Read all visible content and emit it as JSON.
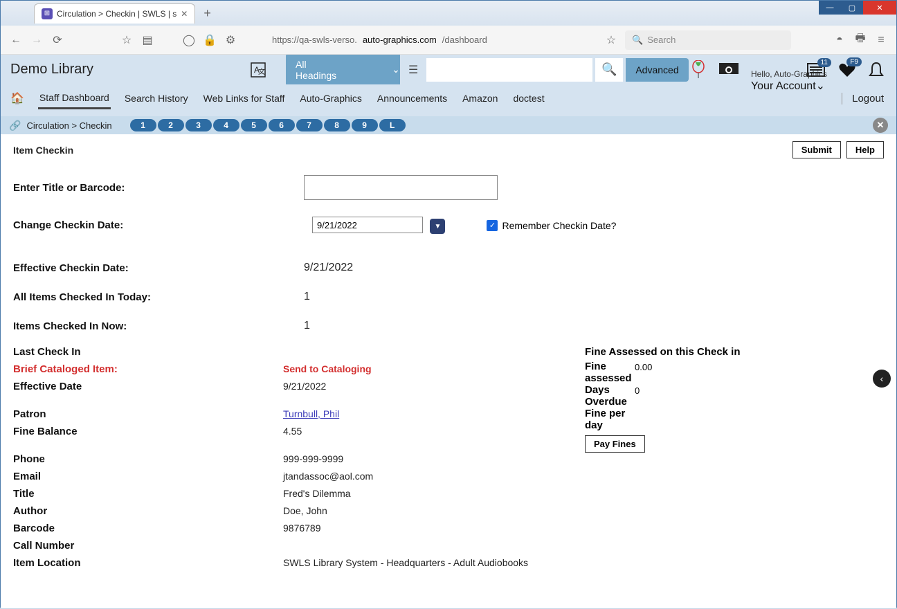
{
  "tab": {
    "title": "Circulation > Checkin | SWLS | s"
  },
  "url": {
    "prefix": "https://qa-swls-verso.",
    "domain": "auto-graphics.com",
    "path": "/dashboard"
  },
  "browser_search_placeholder": "Search",
  "header": {
    "library_name": "Demo Library",
    "heading_dropdown": "All Headings",
    "advanced": "Advanced",
    "badge_list": "11",
    "badge_heart": "F9",
    "hello": "Hello, Auto-Graphics",
    "account": "Your Account",
    "logout": "Logout"
  },
  "nav": {
    "items": [
      "Staff Dashboard",
      "Search History",
      "Web Links for Staff",
      "Auto-Graphics",
      "Announcements",
      "Amazon",
      "doctest"
    ]
  },
  "crumb": {
    "text": "Circulation  >  Checkin",
    "tabs": [
      "1",
      "2",
      "3",
      "4",
      "5",
      "6",
      "7",
      "8",
      "9",
      "L"
    ]
  },
  "page": {
    "title": "Item Checkin",
    "submit": "Submit",
    "help": "Help",
    "labels": {
      "enter": "Enter Title or Barcode:",
      "change_date": "Change Checkin Date:",
      "remember": "Remember Checkin Date?",
      "effective": "Effective Checkin Date:",
      "all_today": "All Items Checked In Today:",
      "now": "Items Checked In Now:"
    },
    "values": {
      "date_input": "9/21/2022",
      "effective_date": "9/21/2022",
      "all_today": "1",
      "now": "1"
    }
  },
  "detail": {
    "labels": {
      "last_checkin": "Last Check In",
      "brief": "Brief Cataloged Item:",
      "effective_date": "Effective Date",
      "patron": "Patron",
      "fine_balance": "Fine Balance",
      "phone": "Phone",
      "email": "Email",
      "title": "Title",
      "author": "Author",
      "barcode": "Barcode",
      "call_number": "Call Number",
      "item_location": "Item Location"
    },
    "send_to": "Send to Cataloging",
    "values": {
      "effective_date": "9/21/2022",
      "patron": "Turnbull, Phil",
      "fine_balance": "4.55",
      "phone": "999-999-9999",
      "email": "jtandassoc@aol.com",
      "title": "Fred's Dilemma",
      "author": "Doe, John",
      "barcode": "9876789",
      "call_number": "",
      "item_location": "SWLS Library System - Headquarters - Adult Audiobooks"
    }
  },
  "fines": {
    "title": "Fine Assessed on this Check in",
    "labels": {
      "assessed": "Fine assessed",
      "overdue": "Days Overdue",
      "per_day": "Fine per day"
    },
    "values": {
      "assessed": "0.00",
      "overdue": "0",
      "per_day": ""
    },
    "pay": "Pay Fines"
  }
}
